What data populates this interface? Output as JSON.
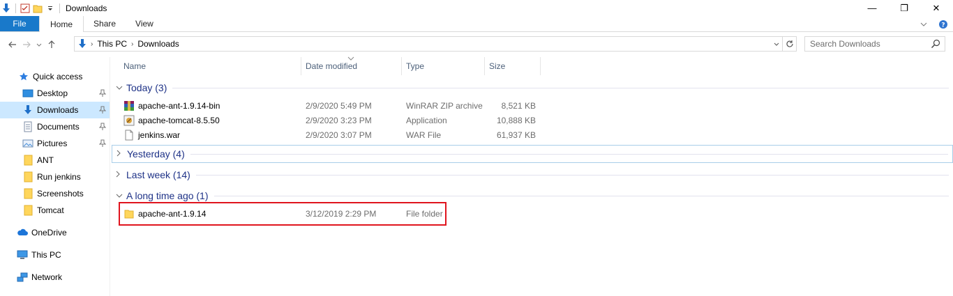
{
  "window": {
    "title": "Downloads",
    "minimize_glyph": "—",
    "restore_glyph": "❐",
    "close_glyph": "✕"
  },
  "ribbon": {
    "file": "File",
    "tabs": [
      "Home",
      "Share",
      "View"
    ]
  },
  "address": {
    "crumbs": [
      "This PC",
      "Downloads"
    ],
    "search_placeholder": "Search Downloads"
  },
  "sidebar": {
    "quick_access": "Quick access",
    "items": [
      {
        "label": "Desktop",
        "pinned": true
      },
      {
        "label": "Downloads",
        "pinned": true,
        "selected": true
      },
      {
        "label": "Documents",
        "pinned": true
      },
      {
        "label": "Pictures",
        "pinned": true
      },
      {
        "label": "ANT"
      },
      {
        "label": "Run jenkins"
      },
      {
        "label": "Screenshots"
      },
      {
        "label": "Tomcat"
      }
    ],
    "onedrive": "OneDrive",
    "this_pc": "This PC",
    "network": "Network"
  },
  "columns": {
    "name": "Name",
    "date": "Date modified",
    "type": "Type",
    "size": "Size"
  },
  "groups": [
    {
      "label": "Today (3)",
      "expanded": true,
      "files": [
        {
          "name": "apache-ant-1.9.14-bin",
          "date": "2/9/2020 5:49 PM",
          "type": "WinRAR ZIP archive",
          "size": "8,521 KB",
          "icon": "winrar-archive-icon"
        },
        {
          "name": "apache-tomcat-8.5.50",
          "date": "2/9/2020 3:23 PM",
          "type": "Application",
          "size": "10,888 KB",
          "icon": "application-icon"
        },
        {
          "name": "jenkins.war",
          "date": "2/9/2020 3:07 PM",
          "type": "WAR File",
          "size": "61,937 KB",
          "icon": "file-icon"
        }
      ]
    },
    {
      "label": "Yesterday (4)",
      "expanded": false,
      "files": []
    },
    {
      "label": "Last week (14)",
      "expanded": false,
      "files": []
    },
    {
      "label": "A long time ago (1)",
      "expanded": true,
      "files": [
        {
          "name": "apache-ant-1.9.14",
          "date": "3/12/2019 2:29 PM",
          "type": "File folder",
          "size": "",
          "icon": "folder-icon"
        }
      ]
    }
  ],
  "colors": {
    "accent": "#1979ca",
    "selection": "#cce8ff",
    "group_text": "#1e3287",
    "highlight_border": "#e0141e"
  }
}
